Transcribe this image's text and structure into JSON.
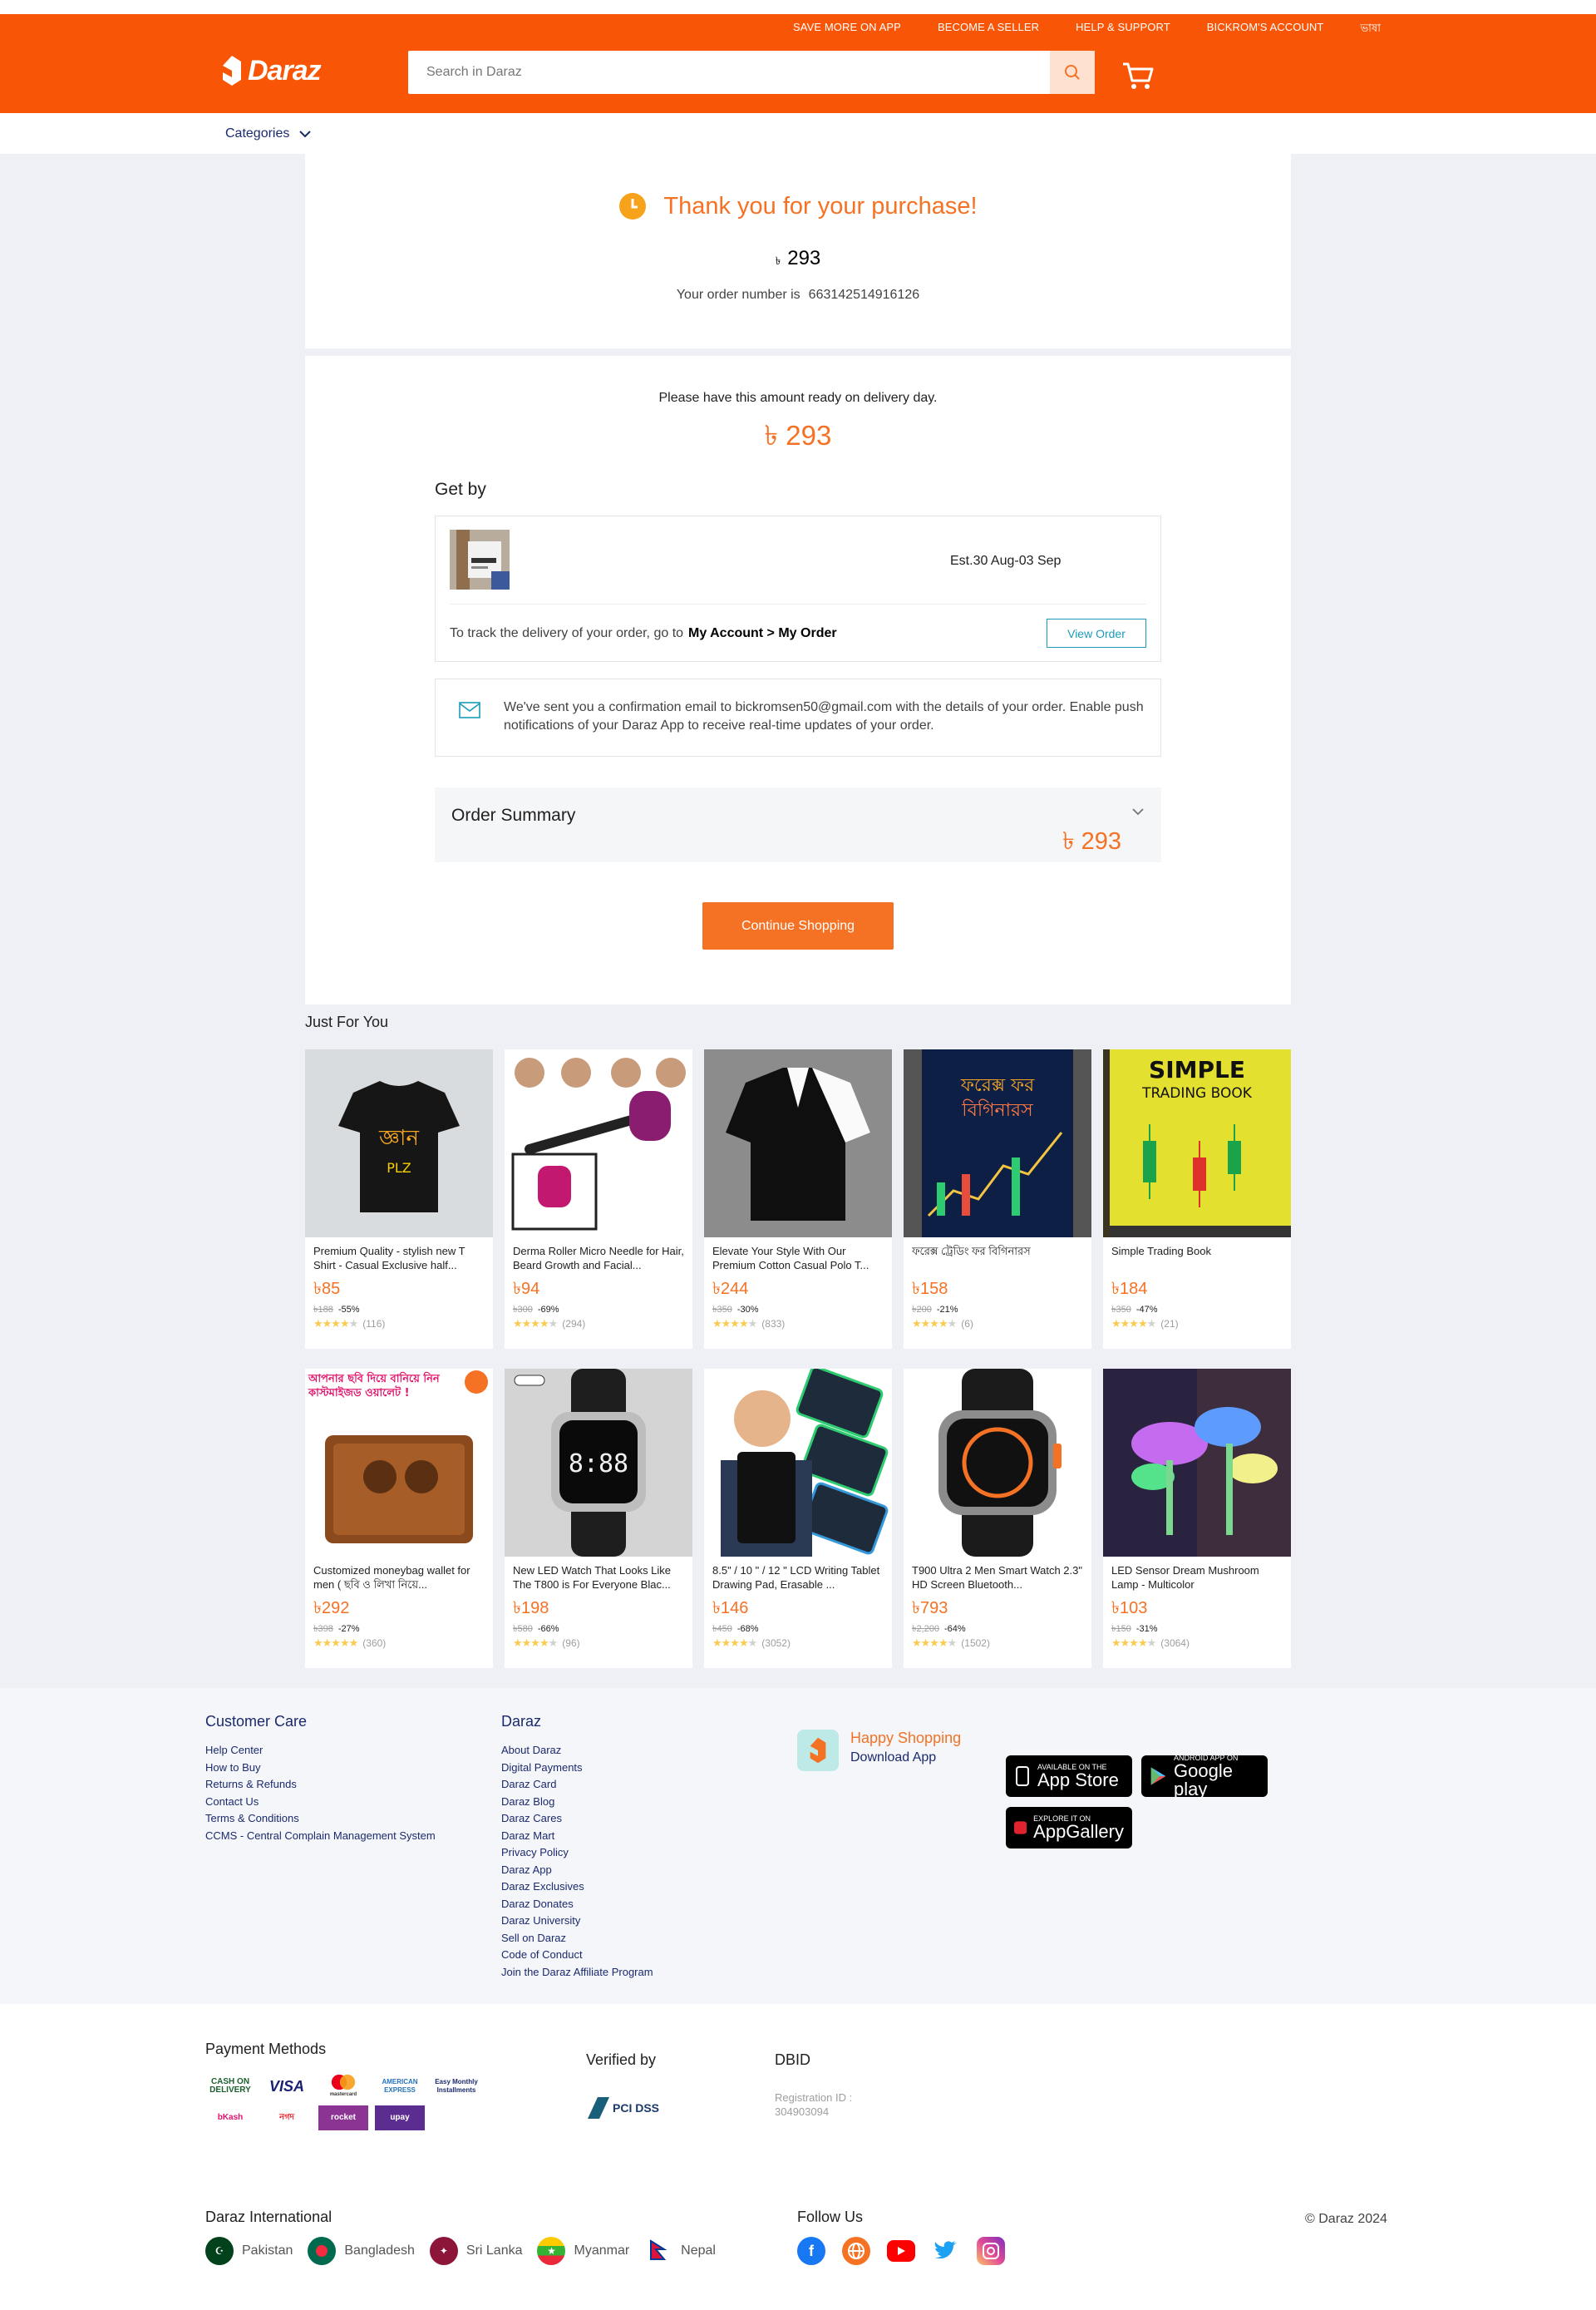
{
  "header": {
    "links": [
      "SAVE MORE ON APP",
      "BECOME A SELLER",
      "HELP & SUPPORT",
      "BICKROM'S ACCOUNT",
      "ভাষা"
    ],
    "logo": "Daraz",
    "search_placeholder": "Search in Daraz",
    "categories": "Categories"
  },
  "confirmation": {
    "title": "Thank you for your purchase!",
    "currency_symbol": "৳",
    "amount": "293",
    "order_label": "Your order number is",
    "order_number": "663142514916126"
  },
  "delivery": {
    "ready_text": "Please have this amount ready on delivery day.",
    "amount": "৳ 293",
    "get_by": "Get by",
    "estimate": "Est.30 Aug-03 Sep",
    "track_text": "To track the delivery of your order, go to",
    "track_link": "My Account > My Order",
    "view_order": "View Order",
    "email_note": "We've sent you a confirmation email to bickromsen50@gmail.com with the details of your order. Enable push notifications of your Daraz App to receive real-time updates of your order.",
    "summary_label": "Order Summary",
    "summary_amount": "৳ 293",
    "continue": "Continue Shopping"
  },
  "jfy": {
    "title": "Just For You",
    "products": [
      {
        "name": "Premium Quality - stylish new T Shirt - Casual Exclusive half...",
        "price": "৳85",
        "old": "৳188",
        "disc": "-55%",
        "rating": 4,
        "reviews": "(116)",
        "art": "tshirt"
      },
      {
        "name": "Derma Roller Micro Needle for Hair, Beard Growth and Facial...",
        "price": "৳94",
        "old": "৳300",
        "disc": "-69%",
        "rating": 4,
        "reviews": "(294)",
        "art": "roller"
      },
      {
        "name": "Elevate Your Style With Our Premium Cotton Casual Polo T...",
        "price": "৳244",
        "old": "৳350",
        "disc": "-30%",
        "rating": 3.5,
        "reviews": "(833)",
        "art": "polo"
      },
      {
        "name": "ফরেক্স ট্রেডিং ফর বিগিনারস",
        "price": "৳158",
        "old": "৳200",
        "disc": "-21%",
        "rating": 3.5,
        "reviews": "(6)",
        "art": "forex"
      },
      {
        "name": "Simple Trading Book",
        "price": "৳184",
        "old": "৳350",
        "disc": "-47%",
        "rating": 3.5,
        "reviews": "(21)",
        "art": "tradebook"
      },
      {
        "name": "Customized moneybag wallet for men ( ছবি ও লিখা নিয়ে...",
        "price": "৳292",
        "old": "৳398",
        "disc": "-27%",
        "rating": 5,
        "reviews": "(360)",
        "art": "wallet"
      },
      {
        "name": "New LED Watch That Looks Like The T800 is For Everyone Blac...",
        "price": "৳198",
        "old": "৳580",
        "disc": "-66%",
        "rating": 3.5,
        "reviews": "(96)",
        "art": "ledwatch"
      },
      {
        "name": "8.5\" / 10 \" / 12 \" LCD Writing Tablet Drawing Pad, Erasable ...",
        "price": "৳146",
        "old": "৳450",
        "disc": "-68%",
        "rating": 4,
        "reviews": "(3052)",
        "art": "tablet"
      },
      {
        "name": "T900 Ultra 2 Men Smart Watch 2.3\" HD Screen Bluetooth...",
        "price": "৳793",
        "old": "৳2,200",
        "disc": "-64%",
        "rating": 4,
        "reviews": "(1502)",
        "art": "smartwatch"
      },
      {
        "name": "LED Sensor Dream Mushroom Lamp - Multicolor",
        "price": "৳103",
        "old": "৳150",
        "disc": "-31%",
        "rating": 4,
        "reviews": "(3064)",
        "art": "lamp"
      }
    ],
    "wallet_banner": "আপনার ছবি দিয়ে বানিয়ে নিন কাস্টমাইজড ওয়ালেট !"
  },
  "footer": {
    "customer_care": {
      "title": "Customer Care",
      "links": [
        "Help Center",
        "How to Buy",
        "Returns & Refunds",
        "Contact Us",
        "Terms & Conditions",
        "CCMS - Central Complain Management System"
      ]
    },
    "daraz": {
      "title": "Daraz",
      "links": [
        "About Daraz",
        "Digital Payments",
        "Daraz Card",
        "Daraz Blog",
        "Daraz Cares",
        "Daraz Mart",
        "Privacy Policy",
        "Daraz App",
        "Daraz Exclusives",
        "Daraz Donates",
        "Daraz University",
        "Sell on Daraz",
        "Code of Conduct",
        "Join the Daraz Affiliate Program"
      ]
    },
    "app": {
      "happy": "Happy Shopping",
      "download": "Download App",
      "appstore_small": "Available on the",
      "appstore": "App Store",
      "googleplay_small": "ANDROID APP ON",
      "googleplay": "Google play",
      "gallery_small": "EXPLORE IT ON",
      "gallery": "AppGallery"
    },
    "payment_title": "Payment Methods",
    "payment_methods": [
      "CASH ON DELIVERY",
      "VISA",
      "mastercard",
      "AMERICAN EXPRESS",
      "Easy Monthly Installments",
      "bKash",
      "নগদ",
      "rocket",
      "upay"
    ],
    "verified_title": "Verified by",
    "pci": "PCI DSS",
    "dbid_title": "DBID",
    "dbid_text": "Registration ID : 304903094",
    "international_title": "Daraz International",
    "countries": [
      "Pakistan",
      "Bangladesh",
      "Sri Lanka",
      "Myanmar",
      "Nepal"
    ],
    "follow_title": "Follow Us",
    "copyright": "© Daraz 2024"
  },
  "colors": {
    "brand": "#f85606",
    "accent": "#f57224",
    "link": "#1a9cb7",
    "navy": "#1a2a6c"
  }
}
